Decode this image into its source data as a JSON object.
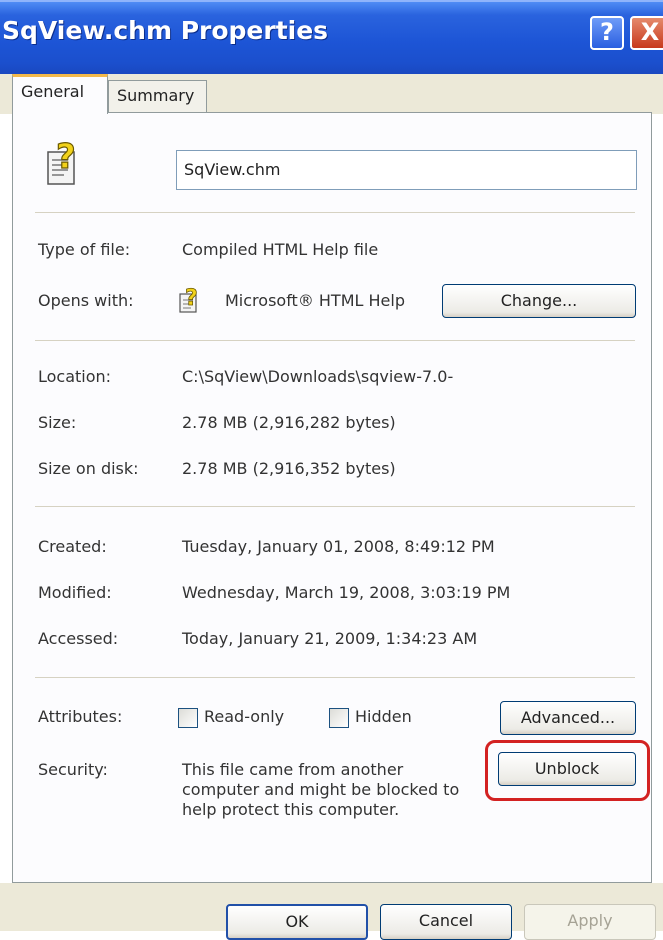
{
  "window": {
    "title": "SqView.chm Properties",
    "help_button": "?",
    "close_button": "X"
  },
  "tabs": [
    {
      "label": "General",
      "selected": true
    },
    {
      "label": "Summary",
      "selected": false
    }
  ],
  "general": {
    "file_icon": "chm-help-file-icon",
    "file_name": "SqView.chm",
    "type_of_file": {
      "label": "Type of file:",
      "value": "Compiled HTML Help file"
    },
    "opens_with": {
      "label": "Opens with:",
      "value": "Microsoft® HTML Help",
      "app_icon": "html-help-icon",
      "change_button": "Change..."
    },
    "location": {
      "label": "Location:",
      "value": "C:\\SqView\\Downloads\\sqview-7.0-"
    },
    "size": {
      "label": "Size:",
      "value": "2.78 MB (2,916,282 bytes)"
    },
    "size_on_disk": {
      "label": "Size on disk:",
      "value": "2.78 MB (2,916,352 bytes)"
    },
    "created": {
      "label": "Created:",
      "value": "Tuesday, January 01, 2008, 8:49:12 PM"
    },
    "modified": {
      "label": "Modified:",
      "value": "Wednesday, March 19, 2008, 3:03:19 PM"
    },
    "accessed": {
      "label": "Accessed:",
      "value": "Today, January 21, 2009, 1:34:23 AM"
    },
    "attributes": {
      "label": "Attributes:",
      "read_only": {
        "label": "Read-only",
        "checked": false
      },
      "hidden": {
        "label": "Hidden",
        "checked": false
      },
      "advanced_button": "Advanced..."
    },
    "security": {
      "label": "Security:",
      "lines": [
        "This file came from another",
        "computer and might be blocked to",
        "help protect this computer."
      ],
      "unblock_button": "Unblock"
    }
  },
  "footer": {
    "ok_button": "OK",
    "cancel_button": "Cancel",
    "apply_button": "Apply",
    "apply_enabled": false
  },
  "colors": {
    "titlebar": "#1d55d6",
    "dialog_bg": "#ece9d8",
    "panel_bg": "#fcfcfe",
    "highlight": "#d32222"
  }
}
